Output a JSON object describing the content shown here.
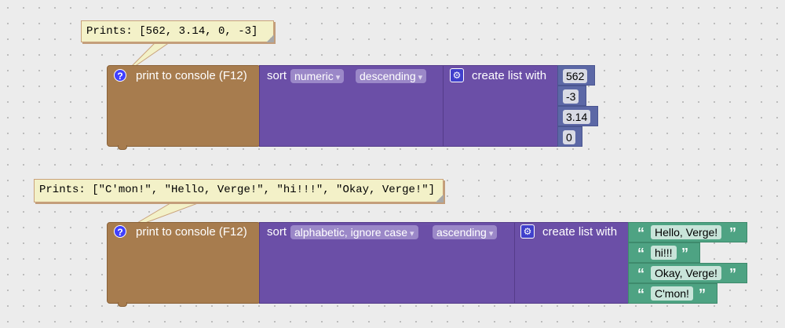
{
  "block1": {
    "tooltip": "Prints: [562, 3.14, 0, -3]",
    "print_label": "print to console (F12)",
    "sort_label": "sort",
    "sort_type": "numeric",
    "sort_order": "descending",
    "create_label": "create list with",
    "items": [
      "562",
      "-3",
      "3.14",
      "0"
    ]
  },
  "block2": {
    "tooltip": "Prints: [\"C'mon!\", \"Hello, Verge!\", \"hi!!!\", \"Okay, Verge!\"]",
    "print_label": "print to console (F12)",
    "sort_label": "sort",
    "sort_type": "alphabetic, ignore case",
    "sort_order": "ascending",
    "create_label": "create list with",
    "items": [
      "Hello, Verge!",
      "hi!!!",
      "Okay, Verge!",
      "C'mon!"
    ]
  },
  "icons": {
    "help": "?",
    "gear": "⚙",
    "dropdown": "▾",
    "open_quote": "“",
    "close_quote": "”"
  },
  "colors": {
    "print_block": "#a77c4e",
    "list_block": "#6b4fa7",
    "number_block": "#5c68a6",
    "text_block": "#4ea383"
  }
}
